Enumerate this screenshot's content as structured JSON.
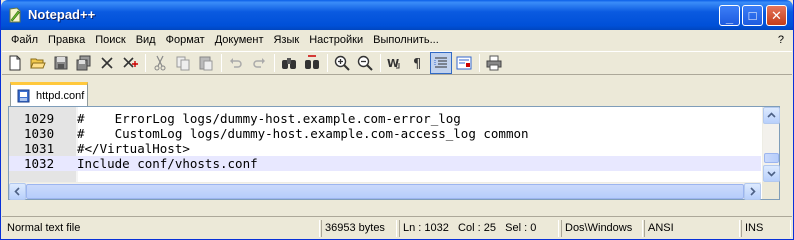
{
  "window": {
    "title": "Notepad++"
  },
  "title_buttons": {
    "minimize": "_",
    "maximize": "□",
    "close": "✕"
  },
  "menu": {
    "items": [
      {
        "label": "Файл"
      },
      {
        "label": "Правка"
      },
      {
        "label": "Поиск"
      },
      {
        "label": "Вид"
      },
      {
        "label": "Формат"
      },
      {
        "label": "Документ"
      },
      {
        "label": "Язык"
      },
      {
        "label": "Настройки"
      },
      {
        "label": "Выполнить..."
      }
    ],
    "help": "?"
  },
  "toolbar": {
    "icons": [
      "new-file-icon",
      "open-folder-icon",
      "save-icon",
      "save-all-icon",
      "close-icon",
      "close-all-icon",
      "cut-icon",
      "copy-icon",
      "paste-icon",
      "undo-icon",
      "redo-icon",
      "find-icon",
      "replace-icon",
      "zoom-in-icon",
      "zoom-out-icon",
      "word-wrap-icon",
      "show-all-chars-icon",
      "indent-guide-icon",
      "macro-record-icon",
      "print-icon"
    ]
  },
  "tab": {
    "label": "httpd.conf",
    "icon": "document-icon"
  },
  "editor": {
    "lines": [
      {
        "number": "1029",
        "text": "#    ErrorLog logs/dummy-host.example.com-error_log",
        "current": false
      },
      {
        "number": "1030",
        "text": "#    CustomLog logs/dummy-host.example.com-access_log common",
        "current": false
      },
      {
        "number": "1031",
        "text": "#</VirtualHost>",
        "current": false
      },
      {
        "number": "1032",
        "text": "Include conf/vhosts.conf",
        "current": true
      }
    ],
    "vertical_scroll_fraction": 0.95
  },
  "statusbar": {
    "file_type": "Normal text file",
    "size": "36953 bytes",
    "position": "Ln : 1032   Col : 25   Sel : 0",
    "eol": "Dos\\Windows",
    "encoding": "ANSI",
    "mode": "INS"
  },
  "colors": {
    "titlebar": "#0a5ae0",
    "current_line": "#e8e8ff",
    "gutter": "#e4e4e4",
    "tab_accent": "#ffc83c"
  }
}
